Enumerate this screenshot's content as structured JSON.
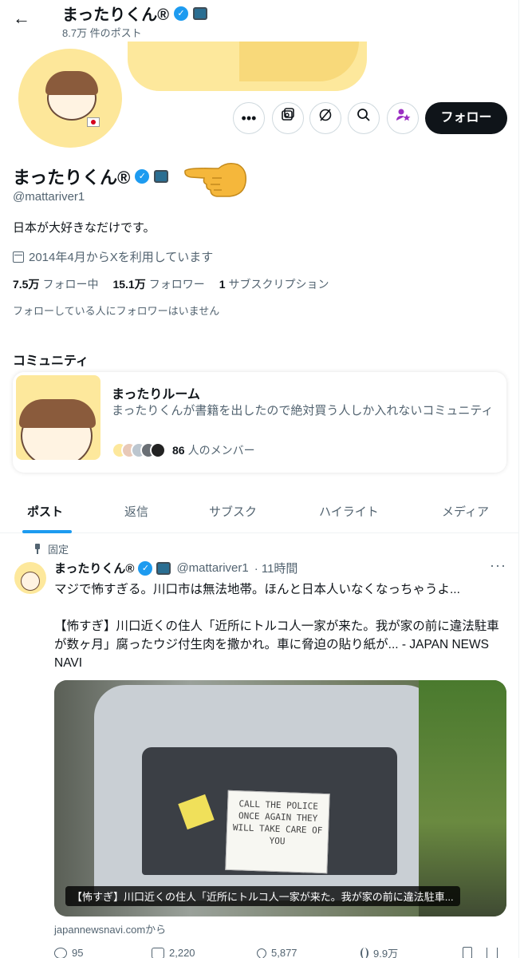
{
  "header": {
    "back_icon": "arrow-left-icon",
    "name": "まったりくん®",
    "post_count": "8.7万 件のポスト"
  },
  "actions": {
    "more": "•••",
    "follow_label": "フォロー"
  },
  "profile": {
    "name": "まったりくん®",
    "handle": "@mattariver1",
    "bio": "日本が大好きなだけです。",
    "joined": "2014年4月からXを利用しています",
    "following_count": "7.5万",
    "following_label": "フォロー中",
    "followers_count": "15.1万",
    "followers_label": "フォロワー",
    "subs_count": "1",
    "subs_label": "サブスクリプション",
    "followed_by": "フォローしている人にフォロワーはいません",
    "pointing_emoji": "👈"
  },
  "community": {
    "section_title": "コミュニティ",
    "name": "まったりルーム",
    "description": "まったりくんが書籍を出したので絶対買う人しか入れないコミュニティ",
    "member_count": "86",
    "member_label": "人のメンバー"
  },
  "tabs": [
    {
      "label": "ポスト",
      "active": true
    },
    {
      "label": "返信",
      "active": false
    },
    {
      "label": "サブスク",
      "active": false
    },
    {
      "label": "ハイライト",
      "active": false
    },
    {
      "label": "メディア",
      "active": false
    }
  ],
  "post": {
    "pinned_label": "固定",
    "author_name": "まったりくん®",
    "author_handle": "@mattariver1",
    "time": "· 11時間",
    "more": "···",
    "text": "マジで怖すぎる。川口市は無法地帯。ほんと日本人いなくなっちゃうよ...",
    "link_text": "【怖すぎ】川口近くの住人「近所にトルコ人一家が来た。我が家の前に違法駐車が数ヶ月」腐ったウジ付生肉を撒かれ。車に脅迫の貼り紙が... - JAPAN NEWS NAVI",
    "media_caption": "【怖すぎ】川口近くの住人「近所にトルコ人一家が来た。我が家の前に違法駐車...",
    "media_sign_text": "CALL THE POLICE ONCE AGAIN THEY WILL TAKE CARE OF YOU",
    "source": "japannewsnavi.comから",
    "replies": "95",
    "reposts": "2,220",
    "likes": "5,877",
    "views": "9.9万"
  },
  "colors": {
    "accent": "#1d9bf0",
    "text": "#0f1419",
    "muted": "#536471",
    "follow_bg": "#0f1419",
    "subscribe_icon": "#9b2fc2"
  }
}
